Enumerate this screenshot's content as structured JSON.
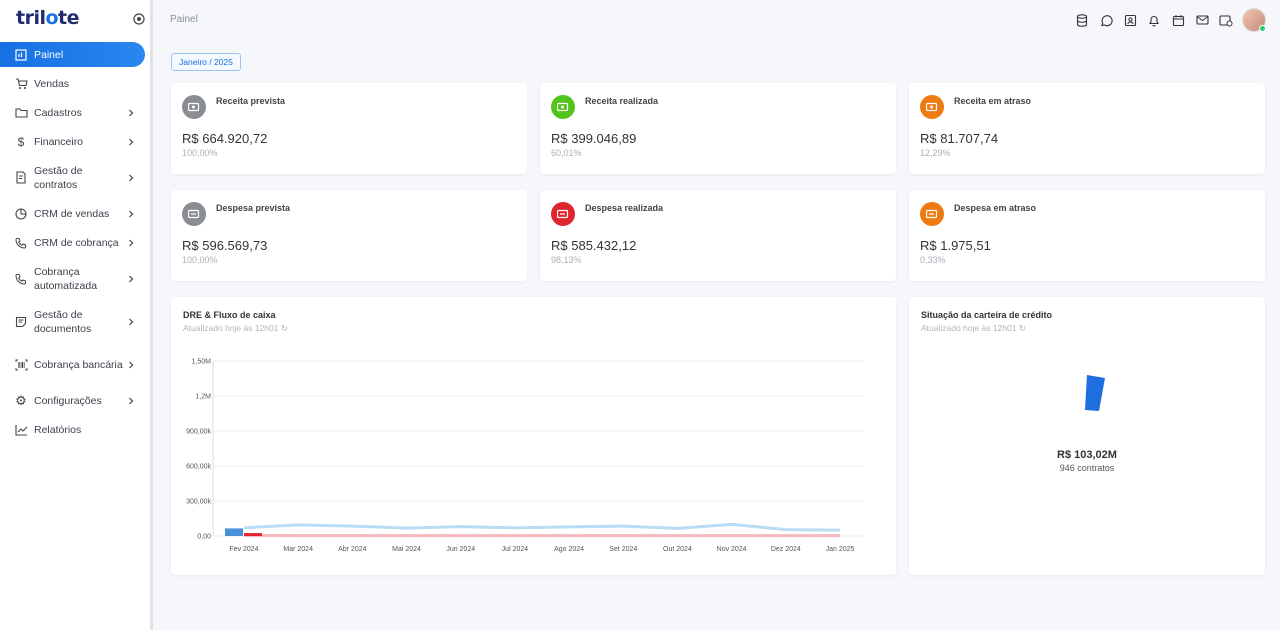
{
  "app": {
    "logo_text_a": "tril",
    "logo_text_b": "o",
    "logo_text_c": "te"
  },
  "breadcrumb": "Painel",
  "sidebar": {
    "items": [
      {
        "label": "Painel",
        "icon": "dashboard-icon"
      },
      {
        "label": "Vendas",
        "icon": "cart-icon"
      },
      {
        "label": "Cadastros",
        "icon": "folder-icon"
      },
      {
        "label": "Financeiro",
        "icon": "dollar-icon"
      },
      {
        "label": "Gestão de contratos",
        "icon": "contract-icon"
      },
      {
        "label": "CRM de vendas",
        "icon": "pie-icon"
      },
      {
        "label": "CRM de cobrança",
        "icon": "phone-icon"
      },
      {
        "label": "Cobrança automatizada",
        "icon": "auto-phone-icon"
      },
      {
        "label": "Gestão de documentos",
        "icon": "document-icon"
      },
      {
        "label": "Cobrança bancária",
        "icon": "barcode-icon"
      },
      {
        "label": "Configurações",
        "icon": "gear-icon"
      },
      {
        "label": "Relatórios",
        "icon": "chart-line-icon"
      }
    ]
  },
  "period": "Janeiro / 2025",
  "kpis": [
    {
      "title": "Receita prevista",
      "value": "R$ 664.920,72",
      "pct": "100,00%",
      "color": "#8a8d92"
    },
    {
      "title": "Receita realizada",
      "value": "R$ 399.046,89",
      "pct": "60,01%",
      "color": "#52c41a"
    },
    {
      "title": "Receita em atraso",
      "value": "R$ 81.707,74",
      "pct": "12,29%",
      "color": "#f07a12"
    },
    {
      "title": "Despesa prevista",
      "value": "R$ 596.569,73",
      "pct": "100,00%",
      "color": "#8a8d92"
    },
    {
      "title": "Despesa realizada",
      "value": "R$ 585.432,12",
      "pct": "98,13%",
      "color": "#e0242f"
    },
    {
      "title": "Despesa em atraso",
      "value": "R$ 1.975,51",
      "pct": "0,33%",
      "color": "#f07a12"
    }
  ],
  "dre": {
    "title": "DRE & Fluxo de caixa",
    "updated": "Atualizado hoje às 12h01"
  },
  "credit": {
    "title": "Situação da carteira de crédito",
    "updated": "Atualizado hoje às 12h01",
    "total": "R$ 103,02M",
    "contracts": "946 contratos",
    "color": "#1d6fe0"
  },
  "chart_data": {
    "type": "line",
    "categories": [
      "Fev 2024",
      "Mar 2024",
      "Abr 2024",
      "Mai 2024",
      "Jun 2024",
      "Jul 2024",
      "Ago 2024",
      "Set 2024",
      "Out 2024",
      "Nov 2024",
      "Dez 2024",
      "Jan 2025"
    ],
    "y_ticks": [
      "0,00",
      "300,00k",
      "600,00k",
      "900,00k",
      "1,2M",
      "1,50M"
    ],
    "ylim": [
      0,
      1500000
    ],
    "grid": true,
    "series": [
      {
        "color": "#b9dcf5",
        "values": [
          70000,
          95000,
          85000,
          68000,
          80000,
          70000,
          78000,
          85000,
          65000,
          100000,
          55000,
          50000
        ]
      },
      {
        "color": "#f4b8bd",
        "values": [
          5000,
          3000,
          3000,
          3000,
          3000,
          3000,
          3000,
          3000,
          3000,
          3000,
          3000,
          3000
        ]
      }
    ],
    "bars": [
      {
        "category": "Fev 2024",
        "color": "#4a8fd9",
        "value": 65000
      },
      {
        "category": "Fev 2024",
        "color": "#e0242f",
        "value": 25000
      }
    ]
  }
}
